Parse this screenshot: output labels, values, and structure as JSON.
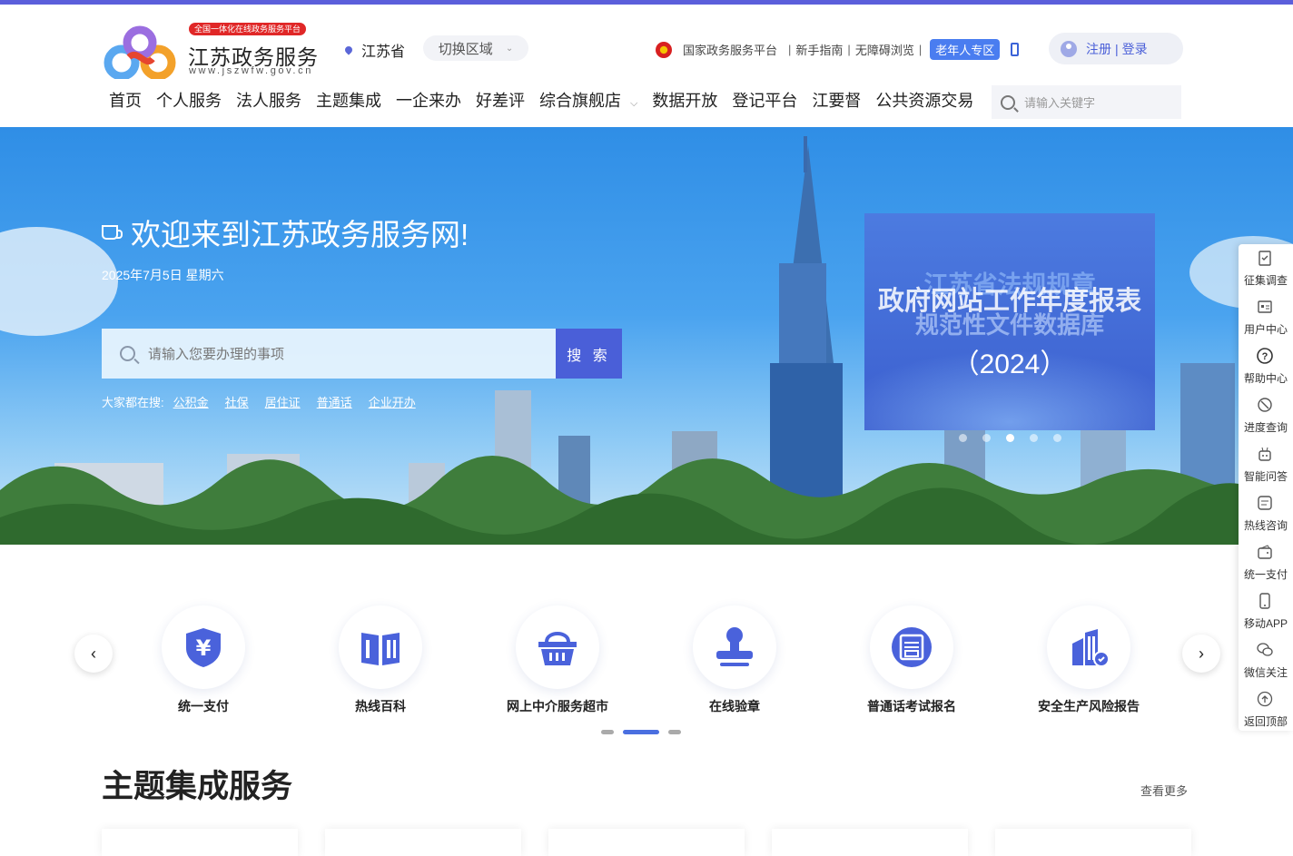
{
  "logo": {
    "badge": "全国一体化在线政务服务平台",
    "title": "江苏政务服务",
    "url": "www.jszwfw.gov.cn"
  },
  "region": {
    "current": "江苏省",
    "switch_label": "切换区域"
  },
  "toplinks": {
    "national": "国家政务服务平台",
    "guide": "新手指南",
    "accessible": "无障碍浏览",
    "elder": "老年人专区"
  },
  "auth": {
    "register": "注册",
    "separator": "|",
    "login": "登录"
  },
  "nav": {
    "items": [
      "首页",
      "个人服务",
      "法人服务",
      "主题集成",
      "一企来办",
      "好差评",
      "综合旗舰店",
      "数据开放",
      "登记平台",
      "江要督",
      "公共资源交易"
    ],
    "active_index": 0,
    "search_placeholder": "请输入关键字"
  },
  "banner": {
    "welcome": "欢迎来到江苏政务服务网!",
    "date": "2025年7月5日 星期六",
    "search_placeholder": "请输入您要办理的事项",
    "search_button": "搜 索",
    "hot_label": "大家都在搜:",
    "hot_keywords": [
      "公积金",
      "社保",
      "居住证",
      "普通话",
      "企业开办"
    ],
    "carousel": {
      "line1": "江苏省法规规章",
      "line2": "政府网站工作年度报表",
      "line3": "规范性文件数据库",
      "year": "（2024）",
      "slide_count": 5,
      "active_slide": 2
    }
  },
  "sidebar": {
    "items": [
      {
        "label": "征集调查",
        "icon": "clipboard-icon"
      },
      {
        "label": "用户中心",
        "icon": "id-card-icon"
      },
      {
        "label": "帮助中心",
        "icon": "help-icon"
      },
      {
        "label": "进度查询",
        "icon": "progress-icon"
      },
      {
        "label": "智能问答",
        "icon": "robot-icon"
      },
      {
        "label": "热线咨询",
        "icon": "message-icon"
      },
      {
        "label": "统一支付",
        "icon": "wallet-icon"
      },
      {
        "label": "移动APP",
        "icon": "mobile-icon"
      },
      {
        "label": "微信关注",
        "icon": "wechat-icon"
      },
      {
        "label": "返回顶部",
        "icon": "back-to-top-icon"
      }
    ]
  },
  "quick_services": {
    "items": [
      {
        "label": "统一支付",
        "icon": "yuan-shield-icon"
      },
      {
        "label": "热线百科",
        "icon": "book-icon"
      },
      {
        "label": "网上中介服务超市",
        "icon": "basket-icon"
      },
      {
        "label": "在线验章",
        "icon": "stamp-icon"
      },
      {
        "label": "普通话考试报名",
        "icon": "putonghua-icon"
      },
      {
        "label": "安全生产风险报告",
        "icon": "building-report-icon"
      }
    ],
    "pages": 3,
    "active_page": 1
  },
  "section": {
    "title": "主题集成服务",
    "more": "查看更多"
  },
  "colors": {
    "accent": "#4a5fd8",
    "topline": "#5b5fdb",
    "elder_badge": "#4a7df0",
    "logo_badge": "#e02727"
  }
}
